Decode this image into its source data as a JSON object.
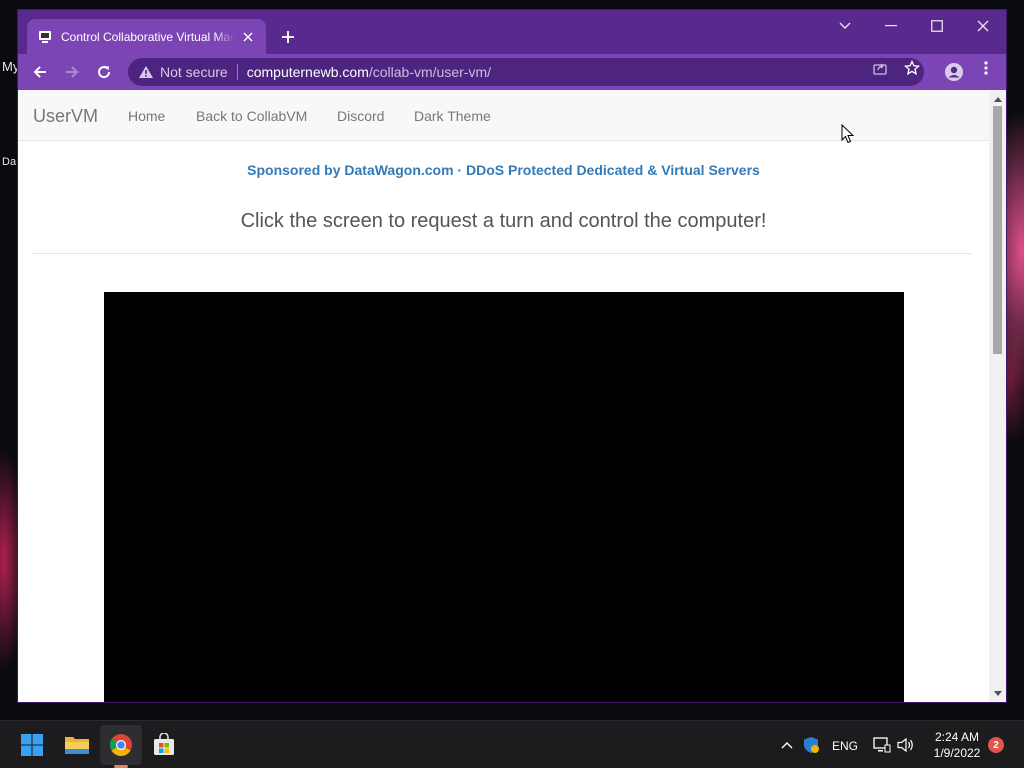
{
  "desktop": {
    "labels": [
      "My",
      "Da"
    ]
  },
  "browser": {
    "tab": {
      "title": "Control Collaborative Virtual Machine",
      "favicon": "collabvm-icon"
    },
    "address_bar": {
      "security_text": "Not secure",
      "url_host": "computernewb.com",
      "url_path": "/collab-vm/user-vm/"
    },
    "theme_color": "#582a8d"
  },
  "page": {
    "navbar": {
      "brand": "UserVM",
      "links": [
        "Home",
        "Back to CollabVM",
        "Discord",
        "Dark Theme"
      ]
    },
    "sponsor_text": "Sponsored by DataWagon.com · DDoS Protected Dedicated & Virtual Servers",
    "prompt_text": "Click the screen to request a turn and control the computer!",
    "link_color": "#337ab7"
  },
  "taskbar": {
    "apps": [
      "start-icon",
      "file-explorer-icon",
      "chrome-icon",
      "microsoft-store-icon"
    ],
    "language": "ENG",
    "time": "2:24 AM",
    "date": "1/9/2022",
    "notification_count": "2"
  }
}
